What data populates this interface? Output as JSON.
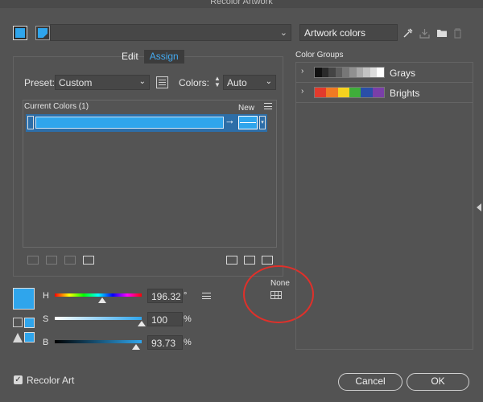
{
  "window": {
    "title": "Recolor Artwork"
  },
  "top": {
    "artwork_name": "Artwork colors"
  },
  "tabs": [
    {
      "label": "Edit",
      "active": false
    },
    {
      "label": "Assign",
      "active": true
    }
  ],
  "assign": {
    "preset_label": "Preset:",
    "preset_value": "Custom",
    "colors_label": "Colors:",
    "colors_value": "Auto",
    "current_colors_label": "Current Colors (1)",
    "new_label": "New"
  },
  "sliders": {
    "h": {
      "label": "H",
      "value": "196.32",
      "unit": "°",
      "fraction": 0.545
    },
    "s": {
      "label": "S",
      "value": "100",
      "unit": "%",
      "fraction": 1.0
    },
    "b": {
      "label": "B",
      "value": "93.73",
      "unit": "%",
      "fraction": 0.9373
    }
  },
  "none_label": "None",
  "color_groups": {
    "label": "Color Groups",
    "items": [
      {
        "name": "Grays",
        "colors": [
          "#111111",
          "#2a2a2a",
          "#444444",
          "#5d5d5d",
          "#777777",
          "#909090",
          "#aaaaaa",
          "#c3c3c3",
          "#dddddd",
          "#ffffff"
        ]
      },
      {
        "name": "Brights",
        "colors": [
          "#e23a2c",
          "#f07a23",
          "#f5d21f",
          "#3fae3a",
          "#2a4fa8",
          "#7a3fa8"
        ]
      }
    ]
  },
  "footer": {
    "recolor_label": "Recolor Art",
    "recolor_checked": true,
    "cancel_label": "Cancel",
    "ok_label": "OK"
  },
  "colors": {
    "accent": "#2fa5ec",
    "highlight": "#e0302a",
    "background": "#535353"
  }
}
